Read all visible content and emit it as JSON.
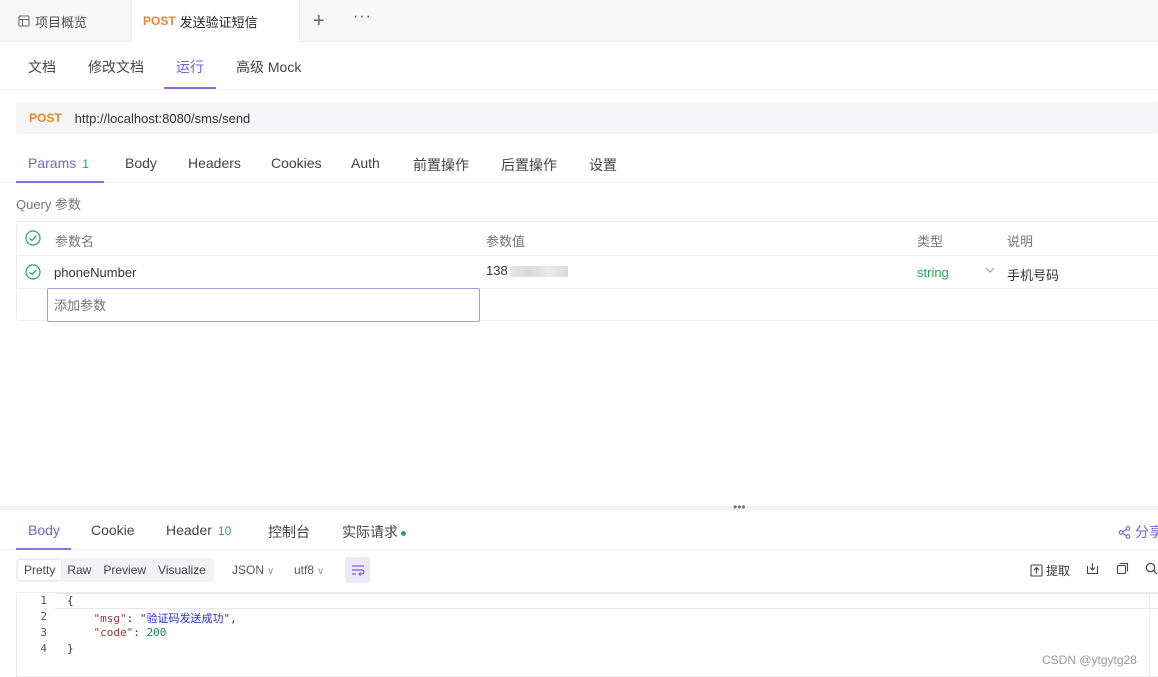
{
  "top_tabs": {
    "overview_label": "项目概览",
    "active_method": "POST",
    "active_label": "发送验证短信",
    "plus": "+",
    "more": "···"
  },
  "sub_tabs": [
    "文档",
    "修改文档",
    "运行",
    "高级 Mock"
  ],
  "sub_tabs_active": "运行",
  "request": {
    "method": "POST",
    "url": "http://localhost:8080/sms/send"
  },
  "param_tabs": {
    "params_label": "Params",
    "params_count": "1",
    "items": [
      "Body",
      "Headers",
      "Cookies",
      "Auth",
      "前置操作",
      "后置操作",
      "设置"
    ]
  },
  "query": {
    "label": "Query 参数",
    "columns": {
      "name": "参数名",
      "value": "参数值",
      "type": "类型",
      "desc": "说明"
    },
    "rows": [
      {
        "name": "phoneNumber",
        "value_visible": "138",
        "type": "string",
        "desc": "手机号码",
        "enabled": true
      }
    ],
    "add_placeholder": "添加参数"
  },
  "response_tabs": {
    "body": "Body",
    "cookie": "Cookie",
    "header": "Header",
    "header_count": "10",
    "console": "控制台",
    "actual_request": "实际请求",
    "share": "分享"
  },
  "response_toolbar": {
    "views": [
      "Pretty",
      "Raw",
      "Preview",
      "Visualize"
    ],
    "active_view": "Pretty",
    "format": "JSON",
    "encoding": "utf8",
    "extract": "提取"
  },
  "response_body": {
    "line_numbers": [
      "1",
      "2",
      "3",
      "4"
    ],
    "open_brace": "{",
    "msg_key": "\"msg\"",
    "msg_value": "\"验证码发送成功\"",
    "code_key": "\"code\"",
    "code_value": "200",
    "close_brace": "}"
  },
  "watermark": "CSDN @ytgytg28",
  "colors": {
    "accent": "#8b6fd6",
    "method_post": "#e8862a",
    "success_green": "#27a857"
  }
}
